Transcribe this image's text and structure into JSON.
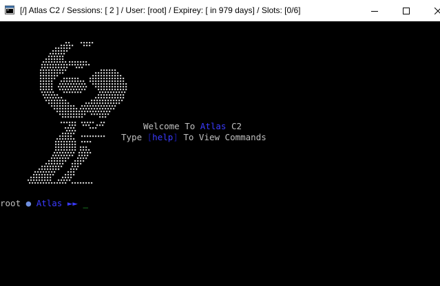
{
  "window": {
    "title": "[/] Atlas C2 / Sessions: [ 2 ] / User: [root] / Expirey: [ in 979 days] / Slots: [0/6]",
    "icon": "console-window-icon",
    "controls": [
      "minimize-icon",
      "maximize-icon",
      "close-icon"
    ]
  },
  "banner": {
    "welcome_prefix": "Welcome To ",
    "welcome_name": "Atlas",
    "welcome_suffix": " C2",
    "help_prefix": "Type ",
    "help_open": "[",
    "help_cmd": "help",
    "help_close": "]",
    "help_suffix": " To View Commands",
    "logo": "atlas-ascii-art-logo"
  },
  "prompt": {
    "user": "root",
    "separator": "●",
    "host": "Atlas",
    "arrows": "►►",
    "cursor": "_"
  },
  "colors": {
    "background": "#000000",
    "text": "#c0c0c0",
    "accent": "#3b3bff",
    "cursor": "#2fdc3a"
  }
}
